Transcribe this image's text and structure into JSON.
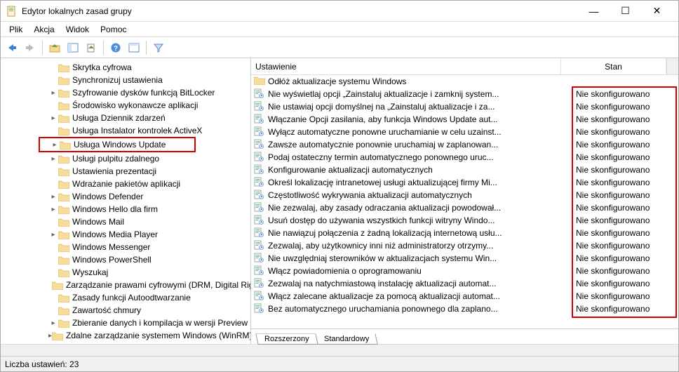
{
  "window": {
    "title": "Edytor lokalnych zasad grupy"
  },
  "menubar": {
    "items": [
      "Plik",
      "Akcja",
      "Widok",
      "Pomoc"
    ]
  },
  "tree": {
    "items": [
      {
        "label": "Skrytka cyfrowa",
        "indent": 4,
        "expander": ""
      },
      {
        "label": "Synchronizuj ustawienia",
        "indent": 4,
        "expander": ""
      },
      {
        "label": "Szyfrowanie dysków funkcją BitLocker",
        "indent": 4,
        "expander": ">"
      },
      {
        "label": "Środowisko wykonawcze aplikacji",
        "indent": 4,
        "expander": ""
      },
      {
        "label": "Usługa Dziennik zdarzeń",
        "indent": 4,
        "expander": ">"
      },
      {
        "label": "Usługa Instalator kontrolek ActiveX",
        "indent": 4,
        "expander": ""
      },
      {
        "label": "Usługa Windows Update",
        "indent": 4,
        "expander": ">",
        "highlighted": true
      },
      {
        "label": "Usługi pulpitu zdalnego",
        "indent": 4,
        "expander": ">"
      },
      {
        "label": "Ustawienia prezentacji",
        "indent": 4,
        "expander": ""
      },
      {
        "label": "Wdrażanie pakietów aplikacji",
        "indent": 4,
        "expander": ""
      },
      {
        "label": "Windows Defender",
        "indent": 4,
        "expander": ">"
      },
      {
        "label": "Windows Hello dla firm",
        "indent": 4,
        "expander": ">"
      },
      {
        "label": "Windows Mail",
        "indent": 4,
        "expander": ""
      },
      {
        "label": "Windows Media Player",
        "indent": 4,
        "expander": ">"
      },
      {
        "label": "Windows Messenger",
        "indent": 4,
        "expander": ""
      },
      {
        "label": "Windows PowerShell",
        "indent": 4,
        "expander": ""
      },
      {
        "label": "Wyszukaj",
        "indent": 4,
        "expander": ""
      },
      {
        "label": "Zarządzanie prawami cyfrowymi (DRM, Digital Rights Management) programu Windows Media",
        "indent": 4,
        "expander": ""
      },
      {
        "label": "Zasady funkcji Autoodtwarzanie",
        "indent": 4,
        "expander": ""
      },
      {
        "label": "Zawartość chmury",
        "indent": 4,
        "expander": ""
      },
      {
        "label": "Zbieranie danych i kompilacja w wersji Preview",
        "indent": 4,
        "expander": ">"
      },
      {
        "label": "Zdalne zarządzanie systemem Windows (WinRM)",
        "indent": 4,
        "expander": ">"
      }
    ]
  },
  "list": {
    "headers": {
      "name": "Ustawienie",
      "state": "Stan"
    },
    "folder_row": {
      "label": "Odłóż aktualizacje systemu Windows"
    },
    "items": [
      {
        "name": "Nie wyświetlaj opcji „Zainstaluj aktualizacje i zamknij system...",
        "state": "Nie skonfigurowano"
      },
      {
        "name": "Nie ustawiaj opcji domyślnej na „Zainstaluj aktualizacje i za...",
        "state": "Nie skonfigurowano"
      },
      {
        "name": "Włączanie Opcji zasilania, aby funkcja Windows Update aut...",
        "state": "Nie skonfigurowano"
      },
      {
        "name": "Wyłącz automatyczne ponowne uruchamianie w celu uzainst...",
        "state": "Nie skonfigurowano"
      },
      {
        "name": "Zawsze automatycznie ponownie uruchamiaj w zaplanowan...",
        "state": "Nie skonfigurowano"
      },
      {
        "name": "Podaj ostateczny termin automatycznego ponownego uruc...",
        "state": "Nie skonfigurowano"
      },
      {
        "name": "Konfigurowanie aktualizacji automatycznych",
        "state": "Nie skonfigurowano"
      },
      {
        "name": "Określ lokalizację intranetowej usługi aktualizującej firmy Mi...",
        "state": "Nie skonfigurowano"
      },
      {
        "name": "Częstotliwość wykrywania aktualizacji automatycznych",
        "state": "Nie skonfigurowano"
      },
      {
        "name": "Nie zezwalaj, aby zasady odraczania aktualizacji powodował...",
        "state": "Nie skonfigurowano"
      },
      {
        "name": "Usuń dostęp do używania wszystkich funkcji witryny Windo...",
        "state": "Nie skonfigurowano"
      },
      {
        "name": "Nie nawiązuj połączenia z żadną lokalizacją internetową usłu...",
        "state": "Nie skonfigurowano"
      },
      {
        "name": "Zezwalaj, aby użytkownicy inni niż administratorzy otrzymy...",
        "state": "Nie skonfigurowano"
      },
      {
        "name": "Nie uwzględniaj sterowników w aktualizacjach systemu Win...",
        "state": "Nie skonfigurowano"
      },
      {
        "name": "Włącz powiadomienia o oprogramowaniu",
        "state": "Nie skonfigurowano"
      },
      {
        "name": "Zezwalaj na natychmiastową instalację aktualizacji automat...",
        "state": "Nie skonfigurowano"
      },
      {
        "name": "Włącz zalecane aktualizacje za pomocą aktualizacji automat...",
        "state": "Nie skonfigurowano"
      },
      {
        "name": "Bez automatycznego uruchamiania ponownego dla zaplano...",
        "state": "Nie skonfigurowano"
      }
    ],
    "tabs": {
      "extended": "Rozszerzony",
      "standard": "Standardowy"
    }
  },
  "statusbar": {
    "text": "Liczba ustawień: 23"
  }
}
